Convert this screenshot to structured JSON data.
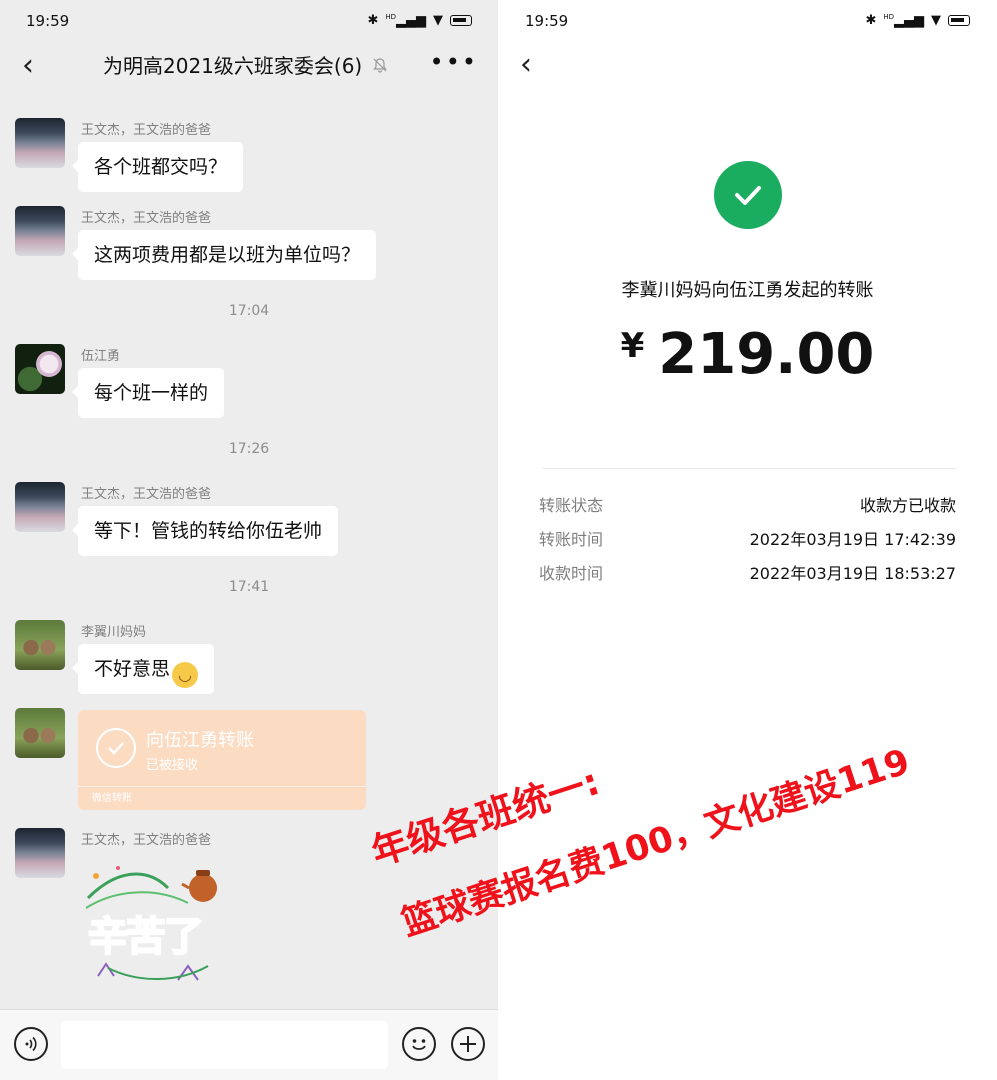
{
  "status_bar": {
    "time": "19:59",
    "icons_text": "HD"
  },
  "chat": {
    "title": "为明高2021级六班家委会(6)",
    "messages": [
      {
        "sender": "王文杰，王文浩的爸爸",
        "text": "各个班都交吗？"
      },
      {
        "sender": "王文杰，王文浩的爸爸",
        "text": "这两项费用都是以班为单位吗？"
      },
      {
        "sender": "伍江勇",
        "text": "每个班一样的"
      },
      {
        "sender": "王文杰，王文浩的爸爸",
        "text": "等下！管钱的转给你伍老帅"
      },
      {
        "sender": "李翼川妈妈",
        "text": "不好意思"
      }
    ],
    "timestamps": [
      "17:04",
      "17:26",
      "17:41"
    ],
    "transfer_card": {
      "title": "向伍江勇转账",
      "status": "已被接收",
      "footer": "微信转账"
    },
    "sticker_sender": "王文杰，王文浩的爸爸",
    "sticker_text": "辛苦了"
  },
  "transfer_detail": {
    "description": "李冀川妈妈向伍江勇发起的转账",
    "currency": "¥",
    "amount": "219.00",
    "rows": [
      {
        "label": "转账状态",
        "value": "收款方已收款"
      },
      {
        "label": "转账时间",
        "value": "2022年03月19日 17:42:39"
      },
      {
        "label": "收款时间",
        "value": "2022年03月19日 18:53:27"
      }
    ]
  },
  "overlay": {
    "line1": "年级各班统一:",
    "line2": "篮球赛报名费100，文化建设119",
    "color": "#f0121b"
  },
  "colors": {
    "chat_bg": "#ededed",
    "success_green": "#1aad5f",
    "transfer_orange": "#fbdcc3"
  }
}
